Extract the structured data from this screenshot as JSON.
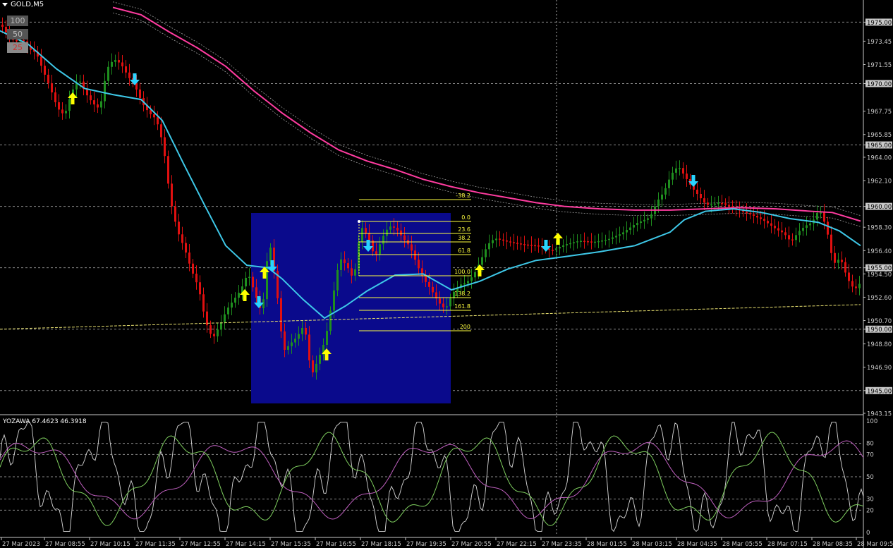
{
  "window": {
    "symbol_label": "GOLD,M5"
  },
  "zoom_buttons": [
    {
      "label": "100",
      "active": false
    },
    {
      "label": "50",
      "active": false
    },
    {
      "label": "25",
      "active": true
    }
  ],
  "colors": {
    "background": "#000000",
    "bull_candle": "#1f8f1f",
    "bear_candle": "#e01010",
    "ma_fast": "#3ec8e8",
    "ma_slow": "#ff3ca0",
    "envelope": "#9a9a9a",
    "trend_line": "#e8e070",
    "highlight_box": "#0a0a8c",
    "fib": "#ffff40",
    "up_arrow": "#ffff00",
    "down_arrow": "#29d4ff"
  },
  "chart_data": [
    {
      "type": "candlestick",
      "symbol": "GOLD",
      "timeframe": "M5",
      "y_range": [
        1943.15,
        1976.0
      ],
      "price_ticks": [
        1975.0,
        1973.45,
        1971.55,
        1970.0,
        1967.75,
        1965.85,
        1965.0,
        1964.0,
        1962.1,
        1960.0,
        1958.3,
        1956.4,
        1955.0,
        1954.5,
        1952.6,
        1950.7,
        1950.0,
        1948.8,
        1946.9,
        1945.0,
        1943.15
      ],
      "highlighted_prices": [
        1975.0,
        1970.0,
        1965.0,
        1960.0,
        1955.0,
        1950.0,
        1945.0
      ],
      "time_labels": [
        "27 Mar 2023",
        "27 Mar 08:55",
        "27 Mar 10:15",
        "27 Mar 11:35",
        "27 Mar 12:55",
        "27 Mar 14:15",
        "27 Mar 15:35",
        "27 Mar 16:55",
        "27 Mar 18:15",
        "27 Mar 19:35",
        "27 Mar 20:55",
        "27 Mar 22:15",
        "27 Mar 23:35",
        "28 Mar 01:55",
        "28 Mar 03:15",
        "28 Mar 04:35",
        "28 Mar 05:55",
        "28 Mar 07:15",
        "28 Mar 08:35",
        "28 Mar 09:5"
      ],
      "fibonacci_levels": [
        "-38.2",
        "0.0",
        "23.6",
        "38.2",
        "61.8",
        "100.0",
        "138.2",
        "161.8",
        "200"
      ],
      "price_path": [
        [
          0,
          1974.8
        ],
        [
          10,
          1973.9
        ],
        [
          20,
          1973.4
        ],
        [
          30,
          1973.6
        ],
        [
          40,
          1972.8
        ],
        [
          50,
          1972.5
        ],
        [
          60,
          1971.0
        ],
        [
          70,
          1969.6
        ],
        [
          80,
          1968.0
        ],
        [
          90,
          1967.4
        ],
        [
          100,
          1969.3
        ],
        [
          110,
          1970.4
        ],
        [
          120,
          1969.2
        ],
        [
          130,
          1968.4
        ],
        [
          140,
          1967.9
        ],
        [
          150,
          1971.2
        ],
        [
          160,
          1972.0
        ],
        [
          170,
          1971.6
        ],
        [
          180,
          1970.6
        ],
        [
          190,
          1969.8
        ],
        [
          200,
          1968.4
        ],
        [
          210,
          1967.6
        ],
        [
          220,
          1967.1
        ],
        [
          230,
          1965.0
        ],
        [
          240,
          1960.5
        ],
        [
          250,
          1958.0
        ],
        [
          260,
          1956.6
        ],
        [
          270,
          1954.8
        ],
        [
          280,
          1953.4
        ],
        [
          290,
          1950.6
        ],
        [
          300,
          1949.2
        ],
        [
          310,
          1950.3
        ],
        [
          320,
          1951.6
        ],
        [
          330,
          1952.4
        ],
        [
          340,
          1953.2
        ],
        [
          350,
          1954.6
        ],
        [
          360,
          1952.9
        ],
        [
          370,
          1951.2
        ],
        [
          380,
          1957.4
        ],
        [
          390,
          1953.6
        ],
        [
          400,
          1948.2
        ],
        [
          410,
          1948.8
        ],
        [
          420,
          1949.4
        ],
        [
          430,
          1950.4
        ],
        [
          440,
          1946.2
        ],
        [
          450,
          1947.6
        ],
        [
          460,
          1949.2
        ],
        [
          470,
          1952.5
        ],
        [
          480,
          1955.8
        ],
        [
          490,
          1955.2
        ],
        [
          500,
          1954.0
        ],
        [
          510,
          1958.4
        ],
        [
          520,
          1957.6
        ],
        [
          530,
          1955.8
        ],
        [
          540,
          1957.4
        ],
        [
          550,
          1958.4
        ],
        [
          560,
          1958.2
        ],
        [
          570,
          1957.4
        ],
        [
          580,
          1956.7
        ],
        [
          590,
          1955.2
        ],
        [
          600,
          1954.0
        ],
        [
          610,
          1953.2
        ],
        [
          620,
          1952.2
        ],
        [
          630,
          1951.6
        ],
        [
          640,
          1952.9
        ],
        [
          650,
          1953.6
        ],
        [
          660,
          1953.8
        ],
        [
          670,
          1954.4
        ],
        [
          680,
          1955.6
        ],
        [
          690,
          1956.9
        ],
        [
          700,
          1957.4
        ],
        [
          720,
          1957.1
        ],
        [
          740,
          1956.9
        ],
        [
          760,
          1956.8
        ],
        [
          780,
          1956.4
        ],
        [
          800,
          1956.9
        ],
        [
          820,
          1957.2
        ],
        [
          840,
          1957.1
        ],
        [
          860,
          1957.3
        ],
        [
          880,
          1957.8
        ],
        [
          900,
          1958.6
        ],
        [
          920,
          1959.1
        ],
        [
          930,
          1960.4
        ],
        [
          940,
          1961.2
        ],
        [
          950,
          1962.6
        ],
        [
          960,
          1963.3
        ],
        [
          970,
          1962.4
        ],
        [
          980,
          1961.5
        ],
        [
          990,
          1960.8
        ],
        [
          1000,
          1960.1
        ],
        [
          1020,
          1960.3
        ],
        [
          1040,
          1959.8
        ],
        [
          1060,
          1959.4
        ],
        [
          1080,
          1958.9
        ],
        [
          1100,
          1958.1
        ],
        [
          1110,
          1957.8
        ],
        [
          1120,
          1957.1
        ],
        [
          1130,
          1957.9
        ],
        [
          1140,
          1958.4
        ],
        [
          1150,
          1958.7
        ],
        [
          1160,
          1959.8
        ],
        [
          1170,
          1958.3
        ],
        [
          1180,
          1955.3
        ],
        [
          1190,
          1955.8
        ],
        [
          1200,
          1954.1
        ],
        [
          1210,
          1953.2
        ],
        [
          1220,
          1953.9
        ]
      ],
      "ma_fast": [
        [
          0,
          1974.3
        ],
        [
          40,
          1973.2
        ],
        [
          80,
          1971.2
        ],
        [
          120,
          1969.6
        ],
        [
          160,
          1969.1
        ],
        [
          200,
          1968.7
        ],
        [
          230,
          1967.0
        ],
        [
          260,
          1963.5
        ],
        [
          290,
          1960.1
        ],
        [
          320,
          1956.8
        ],
        [
          350,
          1955.2
        ],
        [
          380,
          1955.0
        ],
        [
          400,
          1954.1
        ],
        [
          430,
          1952.4
        ],
        [
          460,
          1950.9
        ],
        [
          490,
          1951.9
        ],
        [
          520,
          1953.1
        ],
        [
          560,
          1954.4
        ],
        [
          600,
          1954.5
        ],
        [
          640,
          1953.2
        ],
        [
          680,
          1953.9
        ],
        [
          720,
          1954.9
        ],
        [
          760,
          1955.6
        ],
        [
          800,
          1955.9
        ],
        [
          850,
          1956.3
        ],
        [
          900,
          1956.8
        ],
        [
          950,
          1957.9
        ],
        [
          970,
          1958.9
        ],
        [
          1000,
          1959.6
        ],
        [
          1040,
          1959.8
        ],
        [
          1080,
          1959.5
        ],
        [
          1120,
          1959.0
        ],
        [
          1160,
          1958.7
        ],
        [
          1190,
          1958.0
        ],
        [
          1220,
          1956.8
        ]
      ],
      "ma_slow": [
        [
          160,
          1976.2
        ],
        [
          200,
          1975.6
        ],
        [
          240,
          1974.2
        ],
        [
          280,
          1972.9
        ],
        [
          320,
          1971.4
        ],
        [
          360,
          1969.4
        ],
        [
          400,
          1967.6
        ],
        [
          440,
          1966.0
        ],
        [
          480,
          1964.6
        ],
        [
          520,
          1963.7
        ],
        [
          560,
          1963.0
        ],
        [
          600,
          1962.2
        ],
        [
          640,
          1961.6
        ],
        [
          680,
          1961.1
        ],
        [
          720,
          1960.7
        ],
        [
          760,
          1960.3
        ],
        [
          800,
          1960.0
        ],
        [
          850,
          1959.8
        ],
        [
          900,
          1959.7
        ],
        [
          950,
          1959.7
        ],
        [
          1000,
          1959.8
        ],
        [
          1050,
          1959.9
        ],
        [
          1100,
          1959.8
        ],
        [
          1150,
          1959.6
        ],
        [
          1180,
          1959.5
        ],
        [
          1220,
          1958.8
        ]
      ],
      "trend_line": [
        [
          0,
          1950.0
        ],
        [
          1220,
          1952.0
        ]
      ]
    },
    {
      "type": "line",
      "indicator": "YOZAWA",
      "label": "YOZAWA 67.4623 46.3918",
      "y_range": [
        0,
        100
      ],
      "y_ticks": [
        100,
        80,
        70,
        50,
        30,
        20,
        0
      ]
    }
  ]
}
